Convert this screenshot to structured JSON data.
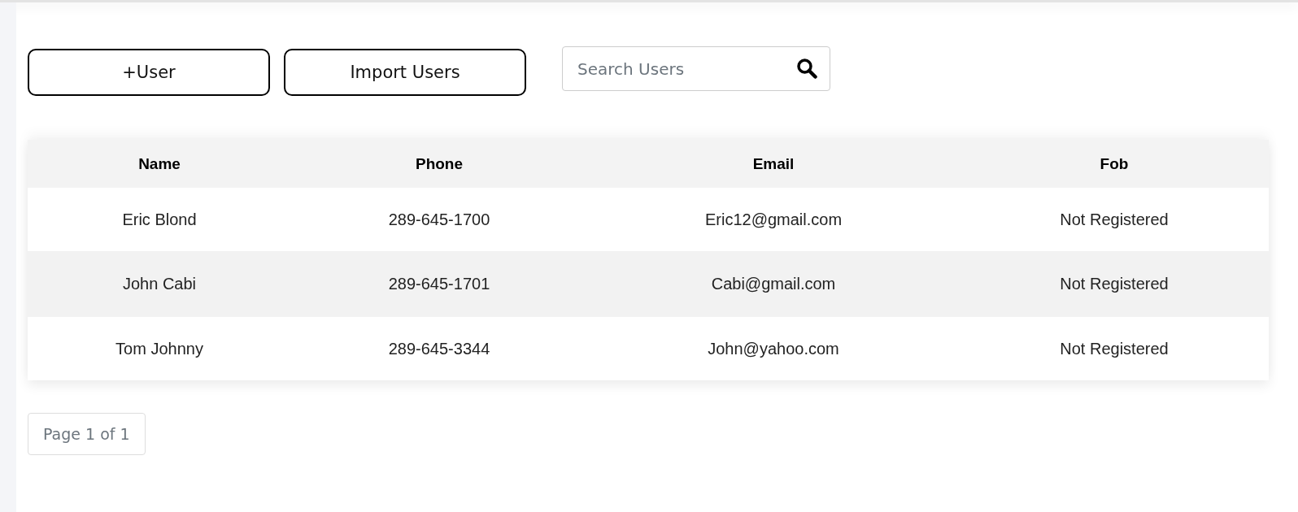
{
  "toolbar": {
    "buttons": [
      "+User",
      "Import Users"
    ],
    "search": {
      "placeholder": "Search Users"
    }
  },
  "table": {
    "columns": [
      "Name",
      "Phone",
      "Email",
      "Fob"
    ],
    "rows": [
      {
        "cells": [
          "Eric Blond",
          "289-645-1700",
          "Eric12@gmail.com",
          "Not Registered"
        ]
      },
      {
        "cells": [
          "John Cabi",
          "289-645-1701",
          "Cabi@gmail.com",
          "Not Registered"
        ]
      },
      {
        "cells": [
          "Tom Johnny",
          "289-645-3344",
          "John@yahoo.com",
          "Not Registered"
        ]
      }
    ]
  },
  "pagination": {
    "label": "Page 1 of 1"
  }
}
